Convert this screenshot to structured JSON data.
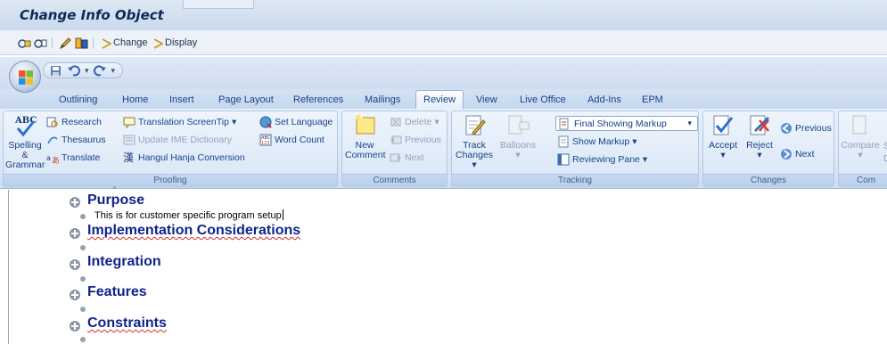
{
  "sap": {
    "title": "Change Info Object",
    "toolbar": {
      "change": "Change",
      "display": "Display"
    }
  },
  "word": {
    "tabs": [
      "Outlining",
      "Home",
      "Insert",
      "Page Layout",
      "References",
      "Mailings",
      "Review",
      "View",
      "Live Office",
      "Add-Ins",
      "EPM"
    ],
    "active_tab": "Review",
    "proofing": {
      "label": "Proofing",
      "spelling_l1": "Spelling &",
      "spelling_l2": "Grammar",
      "research": "Research",
      "thesaurus": "Thesaurus",
      "translate": "Translate",
      "translation_screentip": "Translation ScreenTip",
      "update_ime": "Update IME Dictionary",
      "hangul": "Hangul Hanja Conversion",
      "set_language": "Set Language",
      "word_count": "Word Count"
    },
    "comments": {
      "label": "Comments",
      "new_l1": "New",
      "new_l2": "Comment",
      "delete": "Delete",
      "previous": "Previous",
      "next": "Next"
    },
    "tracking": {
      "label": "Tracking",
      "track_l1": "Track",
      "track_l2": "Changes",
      "balloons": "Balloons",
      "markup_select": "Final Showing Markup",
      "show_markup": "Show Markup",
      "reviewing_pane": "Reviewing Pane"
    },
    "changes": {
      "label": "Changes",
      "accept": "Accept",
      "reject": "Reject",
      "previous": "Previous",
      "next": "Next"
    },
    "compare": {
      "label": "Com",
      "compare": "Compare",
      "show": "S",
      "d": "D"
    }
  },
  "document": {
    "outline": [
      {
        "heading": "Purpose",
        "text": "This is for customer specific program setup"
      },
      {
        "heading": "Implementation Considerations",
        "text": ""
      },
      {
        "heading": "Integration",
        "text": ""
      },
      {
        "heading": "Features",
        "text": ""
      },
      {
        "heading": "Constraints",
        "text": ""
      }
    ]
  },
  "colors": {
    "ribbon_text": "#15428b",
    "heading": "#10248a",
    "ribbon_bg": "#dbe7f7"
  }
}
